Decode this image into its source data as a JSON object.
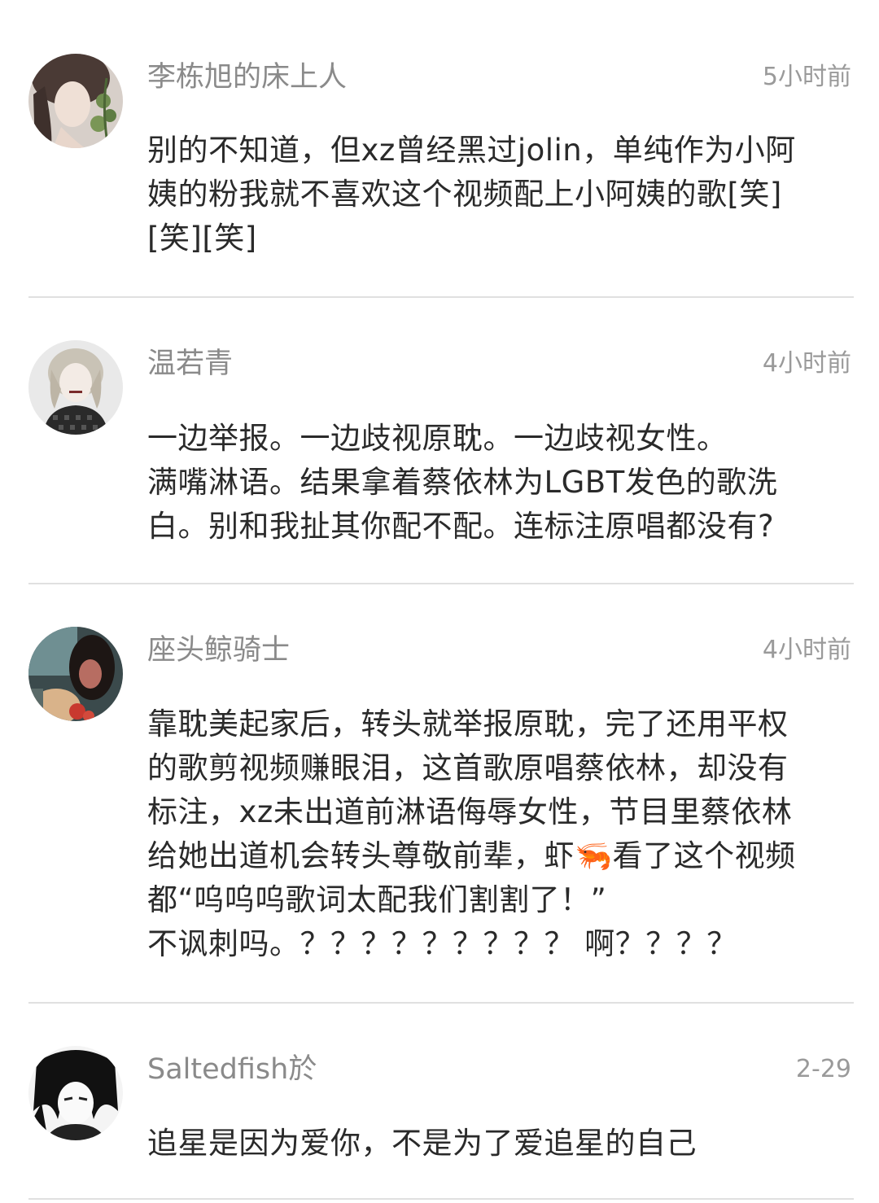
{
  "comments": [
    {
      "username": "李栋旭的床上人",
      "time": "5小时前",
      "avatar": "avatar-girl-with-flower",
      "lines": [
        "别的不知道，但xz曾经黑过jolin，单纯作为小阿",
        "姨的粉我就不喜欢这个视频配上小阿姨的歌[笑]",
        "[笑][笑]"
      ]
    },
    {
      "username": "温若青",
      "time": "4小时前",
      "avatar": "avatar-blonde-woman",
      "lines": [
        "一边举报。一边歧视原耽。一边歧视女性。",
        "满嘴淋语。结果拿着蔡依林为LGBT发色的歌洗",
        "白。别和我扯其你配不配。连标注原唱都没有?"
      ]
    },
    {
      "username": "座头鲸骑士",
      "time": "4小时前",
      "avatar": "avatar-dark-room-portrait",
      "lines": [
        "靠耽美起家后，转头就举报原耽，完了还用平权",
        "的歌剪视频赚眼泪，这首歌原唱蔡依林，却没有",
        "标注，xz未出道前淋语侮辱女性，节目里蔡依林",
        "给她出道机会转头尊敬前辈，虾🦐看了这个视频",
        "都“呜呜呜歌词太配我们割割了！”",
        "不讽刺吗。？？？？？？？？？ 啊？？？？"
      ]
    },
    {
      "username": "Saltedfish於",
      "time": "2-29",
      "avatar": "avatar-anime-sketch",
      "lines": [
        "追星是因为爱你，不是为了爱追星的自己"
      ]
    }
  ]
}
